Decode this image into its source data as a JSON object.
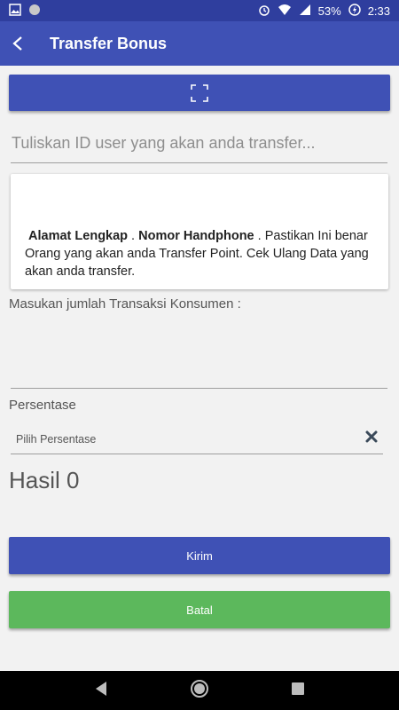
{
  "status_bar": {
    "battery": "53%",
    "time": "2:33"
  },
  "app_bar": {
    "title": "Transfer Bonus"
  },
  "user_id_field": {
    "placeholder": "Tuliskan ID user yang akan anda transfer..."
  },
  "info_card": {
    "bold_1": "Alamat Lengkap",
    "sep_1": " .  ",
    "bold_2": "Nomor Handphone",
    "text": "   . Pastikan Ini benar Orang yang akan anda Transfer Point. Cek Ulang Data yang akan anda transfer."
  },
  "transaction": {
    "label": "Masukan jumlah Transaksi Konsumen :",
    "value": ""
  },
  "percentage": {
    "label": "Persentase",
    "selected": "Pilih Persentase"
  },
  "result": {
    "text": "Hasil 0"
  },
  "buttons": {
    "send": "Kirim",
    "cancel": "Batal"
  },
  "colors": {
    "primary": "#3f51b5",
    "primary_dark": "#2f3e9e",
    "success": "#5cb85c"
  }
}
